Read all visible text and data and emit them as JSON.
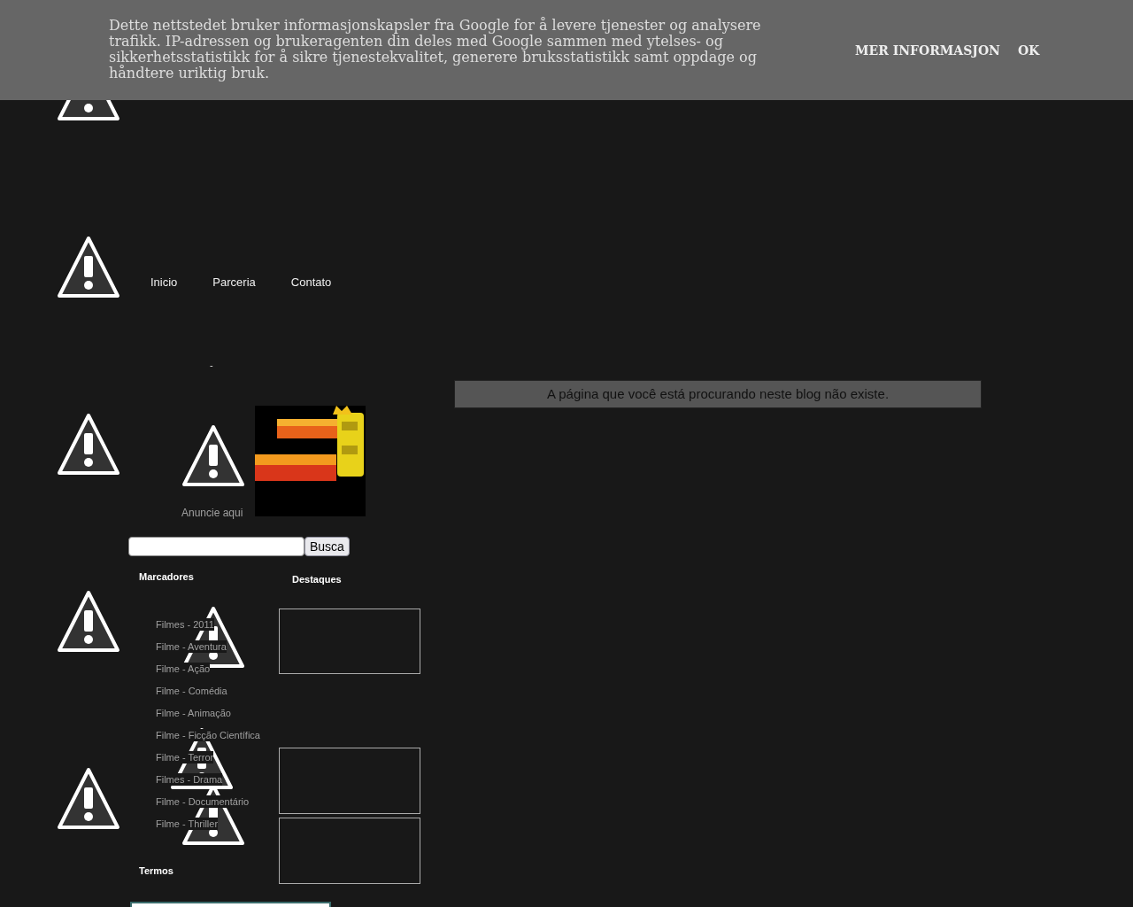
{
  "cookie_banner": {
    "message": "Dette nettstedet bruker informasjonskapsler fra Google for å levere tjenester og analysere trafikk. IP-adressen og brukeragenten din deles med Google sammen med ytelses- og sikkerhetsstatistikk for å sikre tjenestekvalitet, generere bruksstatistikk samt oppdage og håndtere uriktig bruk.",
    "buttons": [
      "MER INFORMASJON",
      "OK"
    ]
  },
  "nav": {
    "items": [
      "Inicio",
      "Parceria",
      "Contato"
    ]
  },
  "sidebar": {
    "dash": "-",
    "ad": {
      "text": "Anuncie aqui"
    },
    "search": {
      "button": "Busca"
    },
    "labels": {
      "title": "Marcadores",
      "items": [
        "Filmes - 2011",
        "Filme - Aventura",
        "Filme - Ação",
        "Filme - Comédia",
        "Filme - Animação",
        "Filme - Ficção Científica",
        "Filme - Terror",
        "Filmes - Drama",
        "Filme - Documentário",
        "Filme - Thriller"
      ]
    },
    "terms": {
      "title": "Termos"
    },
    "featured": {
      "title": "Destaques"
    }
  },
  "main": {
    "error": "A página que você está procurando neste blog não existe."
  }
}
